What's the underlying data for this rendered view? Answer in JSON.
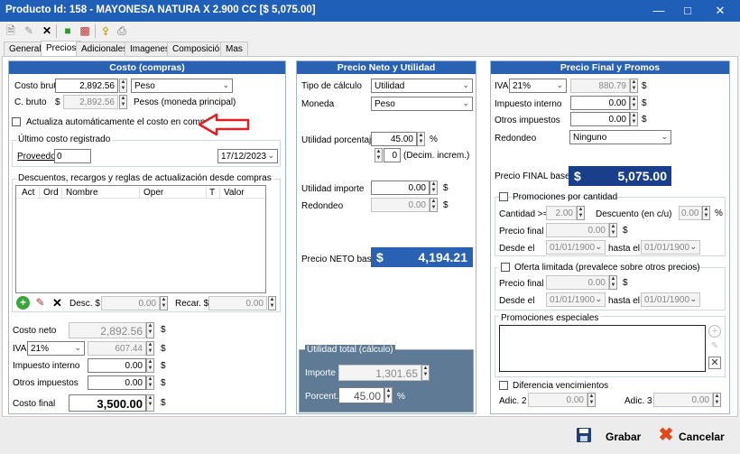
{
  "window": {
    "title": "Producto Id: 158 - MAYONESA NATURA X 2.900 CC [$ 5,075.00]"
  },
  "tabs": [
    "General",
    "Precios",
    "Adicionales",
    "Imagenes",
    "Composición",
    "Mas"
  ],
  "costo": {
    "header": "Costo (compras)",
    "costo_bruto_label": "Costo bruto",
    "costo_bruto_value": "2,892.56",
    "costo_bruto_currency": "Peso",
    "c_bruto_label": "C. bruto",
    "c_bruto_symbol": "$",
    "c_bruto_value": "2,892.56",
    "c_bruto_note": "Pesos (moneda principal)",
    "actualiza_label": "Actualiza automáticamente el costo en compras",
    "ultimo_costo_label": "Último costo registrado",
    "proveedor_label": "Proveedor",
    "proveedor_value": "0",
    "fecha_value": "17/12/2023",
    "descuentos_label": "Descuentos, recargos y reglas de actualización desde compras",
    "columns": [
      "Act",
      "Ord",
      "Nombre",
      "Oper",
      "T",
      "Valor"
    ],
    "desc_label": "Desc. $",
    "desc_value": "0.00",
    "recar_label": "Recar. $",
    "recar_value": "0.00",
    "costo_neto_label": "Costo neto",
    "costo_neto_value": "2,892.56",
    "iva_label": "IVA",
    "iva_rate": "21%",
    "iva_value": "607.44",
    "imp_interno_label": "Impuesto interno",
    "imp_interno_value": "0.00",
    "otros_imp_label": "Otros impuestos",
    "otros_imp_value": "0.00",
    "costo_final_label": "Costo final",
    "costo_final_value": "3,500.00",
    "dollar": "$"
  },
  "neto": {
    "header": "Precio Neto y Utilidad",
    "tipo_calc_label": "Tipo de cálculo",
    "tipo_calc_value": "Utilidad",
    "moneda_label": "Moneda",
    "moneda_value": "Peso",
    "util_pct_label": "Utilidad porcentaje",
    "util_pct_value": "45.00",
    "pct_symbol": "%",
    "decim_value": "0",
    "decim_label": "(Decim. increm.)",
    "util_imp_label": "Utilidad importe",
    "util_imp_value": "0.00",
    "redondeo_label": "Redondeo",
    "redondeo_value": "0.00",
    "precio_neto_label": "Precio NETO base",
    "precio_neto_symbol": "$",
    "precio_neto_value": "4,194.21",
    "util_total_label": "Utilidad total (cálculo)",
    "importe_label": "Importe",
    "importe_value": "1,301.65",
    "porcent_label": "Porcent.",
    "porcent_value": "45.00",
    "dollar": "$"
  },
  "final": {
    "header": "Precio Final y Promos",
    "iva_label": "IVA",
    "iva_rate": "21%",
    "iva_value": "880.79",
    "imp_interno_label": "Impuesto interno",
    "imp_interno_value": "0.00",
    "otros_imp_label": "Otros impuestos",
    "otros_imp_value": "0.00",
    "redondeo_label": "Redondeo",
    "redondeo_value": "Ninguno",
    "precio_final_label": "Precio FINAL base",
    "precio_final_symbol": "$",
    "precio_final_value": "5,075.00",
    "promo_cantidad_label": "Promociones por cantidad",
    "cantidad_label": "Cantidad >=",
    "cantidad_value": "2.00",
    "descuento_label": "Descuento (en c/u)",
    "descuento_value": "0.00",
    "precio_final_label2": "Precio final",
    "pf1_value": "0.00",
    "desde_label": "Desde el",
    "desde_value": "01/01/1900",
    "hasta_label": "hasta el",
    "hasta_value": "01/01/1900",
    "oferta_label": "Oferta limitada (prevalece sobre otros precios)",
    "pf2_value": "0.00",
    "desde2_value": "01/01/1900",
    "hasta2_value": "01/01/1900",
    "promo_esp_label": "Promociones especiales",
    "dif_venc_label": "Diferencia vencimientos",
    "adic2_label": "Adic. 2",
    "adic2_value": "0.00",
    "adic3_label": "Adic. 3",
    "adic3_value": "0.00",
    "dollar": "$",
    "pct": "%"
  },
  "footer": {
    "grabar": "Grabar",
    "cancelar": "Cancelar"
  },
  "colors": {
    "accent": "#2a62b3",
    "title": "#1f5fb8",
    "arrow": "#e02020"
  }
}
